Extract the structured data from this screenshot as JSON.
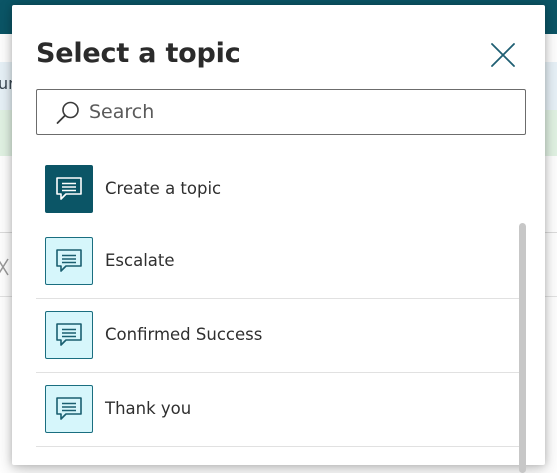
{
  "background": {
    "info_text": "ur"
  },
  "dialog": {
    "title": "Select a topic",
    "close_icon": "close-icon",
    "search": {
      "placeholder": "Search",
      "value": "",
      "icon": "search-icon"
    },
    "topics": [
      {
        "label": "Create a topic",
        "icon": "chat-bubble-icon",
        "style": "primary"
      },
      {
        "label": "Escalate",
        "icon": "chat-bubble-icon",
        "style": "default"
      },
      {
        "label": "Confirmed Success",
        "icon": "chat-bubble-icon",
        "style": "default"
      },
      {
        "label": "Thank you",
        "icon": "chat-bubble-icon",
        "style": "default"
      }
    ]
  },
  "colors": {
    "brand": "#0b5566",
    "icon_tile_bg": "#d6f6fb",
    "info_bar": "#e8f2f8",
    "success_bar": "#e2f3e4"
  }
}
